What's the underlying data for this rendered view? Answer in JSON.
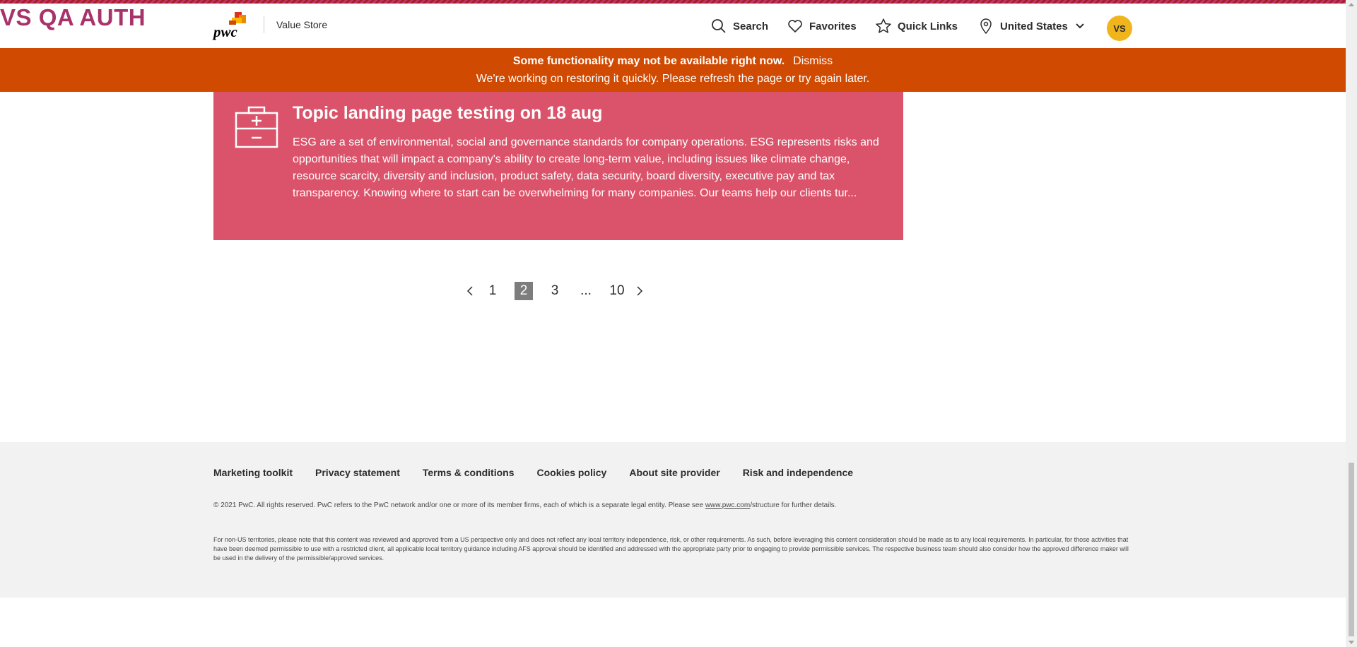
{
  "env_label": "VS QA AUTH",
  "header": {
    "logo_text": "pwc",
    "site_name": "Value Store",
    "nav": {
      "search": "Search",
      "favorites": "Favorites",
      "quick_links": "Quick Links",
      "country": "United States"
    },
    "avatar_initials": "VS"
  },
  "alert": {
    "headline": "Some functionality may not be available right now.",
    "dismiss": "Dismiss",
    "message": "We're working on restoring it quickly. Please refresh the page or try again later."
  },
  "card": {
    "title": "Topic landing page testing on 18 aug",
    "body": "ESG are a set of environmental, social and governance standards for company operations. ESG represents risks and opportunities that will impact a company's ability to create long-term value, including issues like climate change, resource scarcity, diversity and inclusion, product safety, data security, board diversity, executive pay and tax transparency. Knowing where to start can be overwhelming for many companies. Our teams help our clients tur..."
  },
  "pagination": {
    "pages": [
      "1",
      "2",
      "3",
      "...",
      "10"
    ],
    "current": "2"
  },
  "footer": {
    "links": [
      "Marketing toolkit",
      "Privacy statement",
      "Terms & conditions",
      "Cookies policy",
      "About site provider",
      "Risk and independence"
    ],
    "copyright_pre": "© 2021 PwC. All rights reserved. PwC refers to the PwC network and/or one or more of its member firms, each of which is a separate legal entity. Please see ",
    "copyright_link": "www.pwc.com",
    "copyright_post": "/structure for further details.",
    "disclaimer": "For non-US territories, please note that this content was reviewed and approved from a US perspective only and does not reflect any local territory independence, risk, or other requirements. As such, before leveraging this content consideration should be made as to any local requirements. In particular, for those activities that have been deemed permissible to use with a restricted client, all applicable local territory guidance including AFS approval should be identified and addressed with the appropriate party prior to engaging to provide permissible services. The respective business team should also consider how the approved difference maker will be used in the delivery of the permissible/approved services."
  },
  "colors": {
    "alert_bg": "#d04a02",
    "card_bg": "#db536a",
    "env_label": "#a8336a",
    "avatar_bg": "#f0b41c",
    "active_page_bg": "#7d7d7d"
  }
}
